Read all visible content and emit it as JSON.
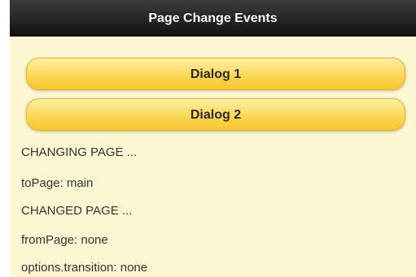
{
  "header": {
    "title": "Page Change Events"
  },
  "buttons": {
    "dialog1": "Dialog 1",
    "dialog2": "Dialog 2"
  },
  "log": [
    "CHANGING PAGE ...",
    "toPage: main",
    "CHANGED PAGE ...",
    "fromPage: none",
    "options.transition: none"
  ],
  "colors": {
    "header_bg": "#1a1a1a",
    "content_bg": "#fdf6d2",
    "button_bg": "#fbd34a"
  }
}
